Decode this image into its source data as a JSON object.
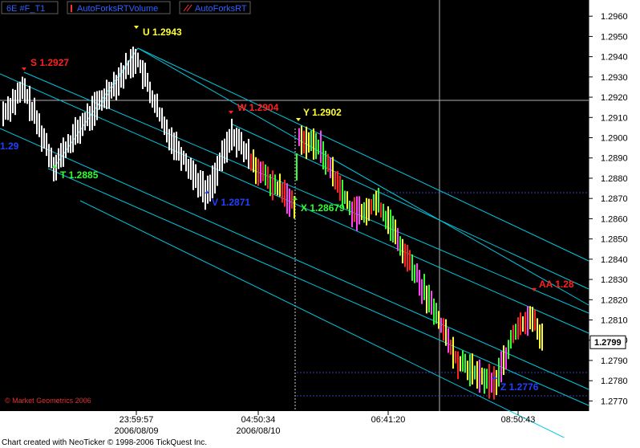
{
  "window": {
    "tabs": [
      {
        "label": "6E #F_T1"
      },
      {
        "label": "AutoForksRTVolume"
      },
      {
        "label": "AutoForksRT"
      }
    ],
    "copyright": "© Market Geometrics 2006",
    "footer": "Chart created with NeoTicker © 1998-2006 TickQuest Inc.",
    "colors": {
      "background": "#000000",
      "grid": "#ffffff",
      "fork_lines": "#00c8e0",
      "bars": "#ffffff",
      "label_red": "#ff2020",
      "label_yellow": "#ffff30",
      "label_blue": "#2040ff",
      "label_green": "#30ff30",
      "axis_text": "#000000",
      "axis_bg": "#ffffff"
    }
  },
  "chart_data": {
    "type": "ohlc",
    "y_axis": {
      "min": 1.2765,
      "max": 1.2968,
      "ticks": [
        "1.2960",
        "1.2950",
        "1.2940",
        "1.2930",
        "1.2920",
        "1.2910",
        "1.2900",
        "1.2890",
        "1.2880",
        "1.2870",
        "1.2860",
        "1.2850",
        "1.2840",
        "1.2830",
        "1.2820",
        "1.2810",
        "1.2800",
        "1.2790",
        "1.2780",
        "1.2770"
      ],
      "current_price": "1.2799"
    },
    "x_axis": {
      "time_labels": [
        "23:59:57",
        "04:50:34",
        "06:41:20",
        "08:50:43"
      ],
      "date_labels": [
        "2006/08/09",
        "2006/08/10"
      ]
    },
    "pivots": [
      {
        "label": "S",
        "value": "1.2927",
        "color": "red"
      },
      {
        "label": "T",
        "value": "1.2885",
        "color": "green"
      },
      {
        "label": "U",
        "value": "1.2943",
        "color": "yellow"
      },
      {
        "label": "V",
        "value": "1.2871",
        "color": "blue"
      },
      {
        "label": "W",
        "value": "1.2904",
        "color": "red"
      },
      {
        "label": "X",
        "value": "1.28679",
        "color": "green"
      },
      {
        "label": "Y",
        "value": "1.2902",
        "color": "yellow"
      },
      {
        "label": "Z",
        "value": "1.2776",
        "color": "blue"
      },
      {
        "label": "AA",
        "value": "1.28",
        "color": "red"
      }
    ],
    "edge_label": "1.29"
  }
}
